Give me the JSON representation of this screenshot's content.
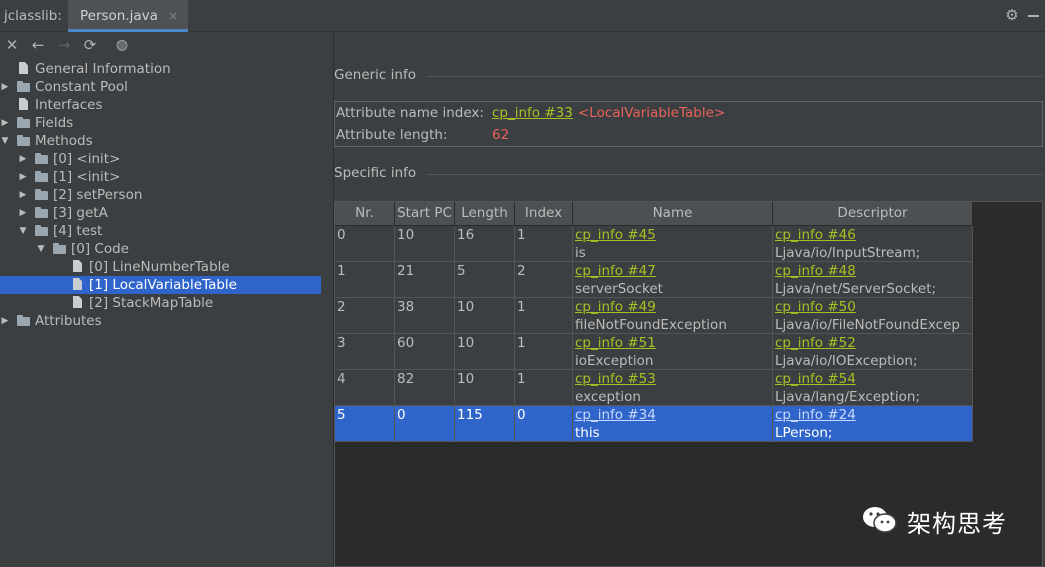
{
  "tool_label": "jclasslib:",
  "tab": {
    "label": "Person.java",
    "close": "×"
  },
  "toolbar": [
    "close",
    "back",
    "forward",
    "refresh",
    "browser"
  ],
  "tree": [
    {
      "label": "General Information",
      "type": "doc",
      "arrow": "",
      "level": 0
    },
    {
      "label": "Constant Pool",
      "type": "folder",
      "arrow": "▶",
      "level": 0
    },
    {
      "label": "Interfaces",
      "type": "doc",
      "arrow": "",
      "level": 0
    },
    {
      "label": "Fields",
      "type": "folder",
      "arrow": "▶",
      "level": 0
    },
    {
      "label": "Methods",
      "type": "folder",
      "arrow": "▼",
      "level": 0
    },
    {
      "label": "[0] <init>",
      "type": "folder",
      "arrow": "▶",
      "level": 1
    },
    {
      "label": "[1] <init>",
      "type": "folder",
      "arrow": "▶",
      "level": 1
    },
    {
      "label": "[2] setPerson",
      "type": "folder",
      "arrow": "▶",
      "level": 1
    },
    {
      "label": "[3] getA",
      "type": "folder",
      "arrow": "▶",
      "level": 1
    },
    {
      "label": "[4] test",
      "type": "folder",
      "arrow": "▼",
      "level": 1
    },
    {
      "label": "[0] Code",
      "type": "folder",
      "arrow": "▼",
      "level": 2
    },
    {
      "label": "[0] LineNumberTable",
      "type": "doc",
      "arrow": "",
      "level": 3
    },
    {
      "label": "[1] LocalVariableTable",
      "type": "doc",
      "arrow": "",
      "level": 3,
      "selected": true
    },
    {
      "label": "[2] StackMapTable",
      "type": "doc",
      "arrow": "",
      "level": 3
    },
    {
      "label": "Attributes",
      "type": "folder",
      "arrow": "▶",
      "level": 0
    }
  ],
  "generic": {
    "title": "Generic info",
    "name_index_label": "Attribute name index:",
    "name_index_link": "cp_info #33",
    "name_index_value": "<LocalVariableTable>",
    "length_label": "Attribute length:",
    "length_value": "62"
  },
  "specific": {
    "title": "Specific info"
  },
  "table": {
    "headers": [
      "Nr.",
      "Start PC",
      "Length",
      "Index",
      "Name",
      "Descriptor"
    ],
    "rows": [
      {
        "nr": "0",
        "start_pc": "10",
        "length": "16",
        "index": "1",
        "name_link": "cp_info #45",
        "name": "is",
        "desc_link": "cp_info #46",
        "desc": "Ljava/io/InputStream;"
      },
      {
        "nr": "1",
        "start_pc": "21",
        "length": "5",
        "index": "2",
        "name_link": "cp_info #47",
        "name": "serverSocket",
        "desc_link": "cp_info #48",
        "desc": "Ljava/net/ServerSocket;"
      },
      {
        "nr": "2",
        "start_pc": "38",
        "length": "10",
        "index": "1",
        "name_link": "cp_info #49",
        "name": "fileNotFoundException",
        "desc_link": "cp_info #50",
        "desc": "Ljava/io/FileNotFoundExcep"
      },
      {
        "nr": "3",
        "start_pc": "60",
        "length": "10",
        "index": "1",
        "name_link": "cp_info #51",
        "name": "ioException",
        "desc_link": "cp_info #52",
        "desc": "Ljava/io/IOException;"
      },
      {
        "nr": "4",
        "start_pc": "82",
        "length": "10",
        "index": "1",
        "name_link": "cp_info #53",
        "name": "exception",
        "desc_link": "cp_info #54",
        "desc": "Ljava/lang/Exception;"
      },
      {
        "nr": "5",
        "start_pc": "0",
        "length": "115",
        "index": "0",
        "name_link": "cp_info #34",
        "name": "this",
        "desc_link": "cp_info #24",
        "desc": "LPerson;",
        "selected": true
      }
    ]
  },
  "watermark": {
    "text": "架构思考"
  },
  "colors": {
    "background": "#3c3f41",
    "selection": "#2f65ca",
    "link": "#a8c023",
    "value_red": "#e8625a"
  }
}
